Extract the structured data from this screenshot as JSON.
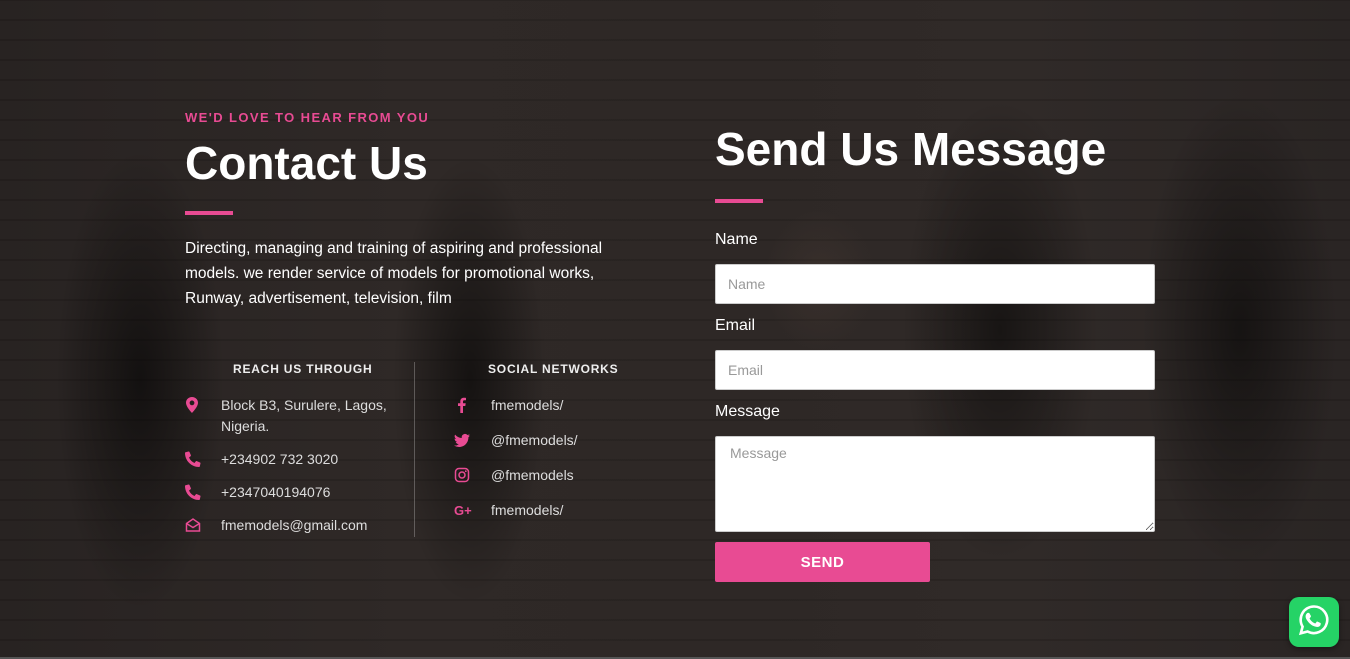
{
  "contact": {
    "eyebrow": "WE'D LOVE TO HEAR FROM YOU",
    "title": "Contact Us",
    "intro": "Directing, managing and training of aspiring and professional models. we render service of models for promotional works, Runway, advertisement, television, film"
  },
  "reach": {
    "heading": "REACH US THROUGH",
    "items": [
      {
        "icon": "map-marker-icon",
        "text": "Block B3, Surulere, Lagos, Nigeria."
      },
      {
        "icon": "phone-icon",
        "text": "+234902 732 3020"
      },
      {
        "icon": "phone-icon",
        "text": "+2347040194076"
      },
      {
        "icon": "envelope-icon",
        "text": "fmemodels@gmail.com"
      }
    ]
  },
  "social": {
    "heading": "SOCIAL NETWORKS",
    "items": [
      {
        "icon": "facebook-icon",
        "text": "fmemodels/"
      },
      {
        "icon": "twitter-icon",
        "text": "@fmemodels/"
      },
      {
        "icon": "instagram-icon",
        "text": "@fmemodels"
      },
      {
        "icon": "google-plus-icon",
        "text": "fmemodels/"
      }
    ]
  },
  "form": {
    "title": "Send Us Message",
    "name_label": "Name",
    "name_placeholder": "Name",
    "email_label": "Email",
    "email_placeholder": "Email",
    "message_label": "Message",
    "message_placeholder": "Message",
    "submit_label": "SEND"
  },
  "colors": {
    "accent": "#e84b93",
    "whatsapp": "#25d366"
  },
  "floating": {
    "icon": "whatsapp-icon"
  }
}
